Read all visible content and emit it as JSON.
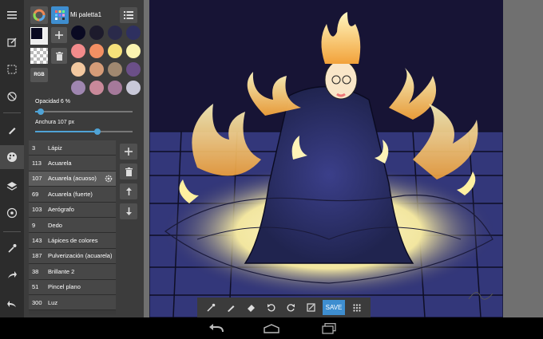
{
  "palette": {
    "name": "Mi paletta1",
    "swatches": [
      "#0a0a22",
      "#1d1b2c",
      "#2a2a4a",
      "#2e3060",
      "#f28b8b",
      "#f39063",
      "#f6e27a",
      "#fbf4b0",
      "#f2c8a0",
      "#d69c78",
      "#a08870",
      "#6b4f88",
      "#9f86b0",
      "#c9899a",
      "#a5799a",
      "#c8c8d8"
    ],
    "rgb_label": "RGB"
  },
  "opacity": {
    "label": "Opacidad 6 %",
    "value_pct": 6
  },
  "width": {
    "label": "Anchura 107 px",
    "value_pct": 64
  },
  "brushes": [
    {
      "num": "3",
      "name": "Lápiz"
    },
    {
      "num": "113",
      "name": "Acuarela"
    },
    {
      "num": "107",
      "name": "Acuarela (acuoso)",
      "selected": true
    },
    {
      "num": "69",
      "name": "Acuarela (fuerte)"
    },
    {
      "num": "103",
      "name": "Aerógrafo"
    },
    {
      "num": "9",
      "name": "Dedo"
    },
    {
      "num": "143",
      "name": "Lápices de colores"
    },
    {
      "num": "187",
      "name": "Pulverización (acuarela)"
    },
    {
      "num": "38",
      "name": "Brillante 2"
    },
    {
      "num": "51",
      "name": "Pincel plano"
    },
    {
      "num": "300",
      "name": "Luz"
    }
  ],
  "bottom_toolbar": {
    "save_label": "SAVE"
  },
  "colors": {
    "accent": "#3e8ed0"
  },
  "icons": {
    "left": [
      "menu-icon",
      "edit-canvas-icon",
      "select-icon",
      "rotate-icon",
      "brush-icon",
      "palette-icon",
      "layers-icon",
      "settings-icon",
      "eyedropper-icon",
      "share-icon",
      "back-icon"
    ]
  }
}
